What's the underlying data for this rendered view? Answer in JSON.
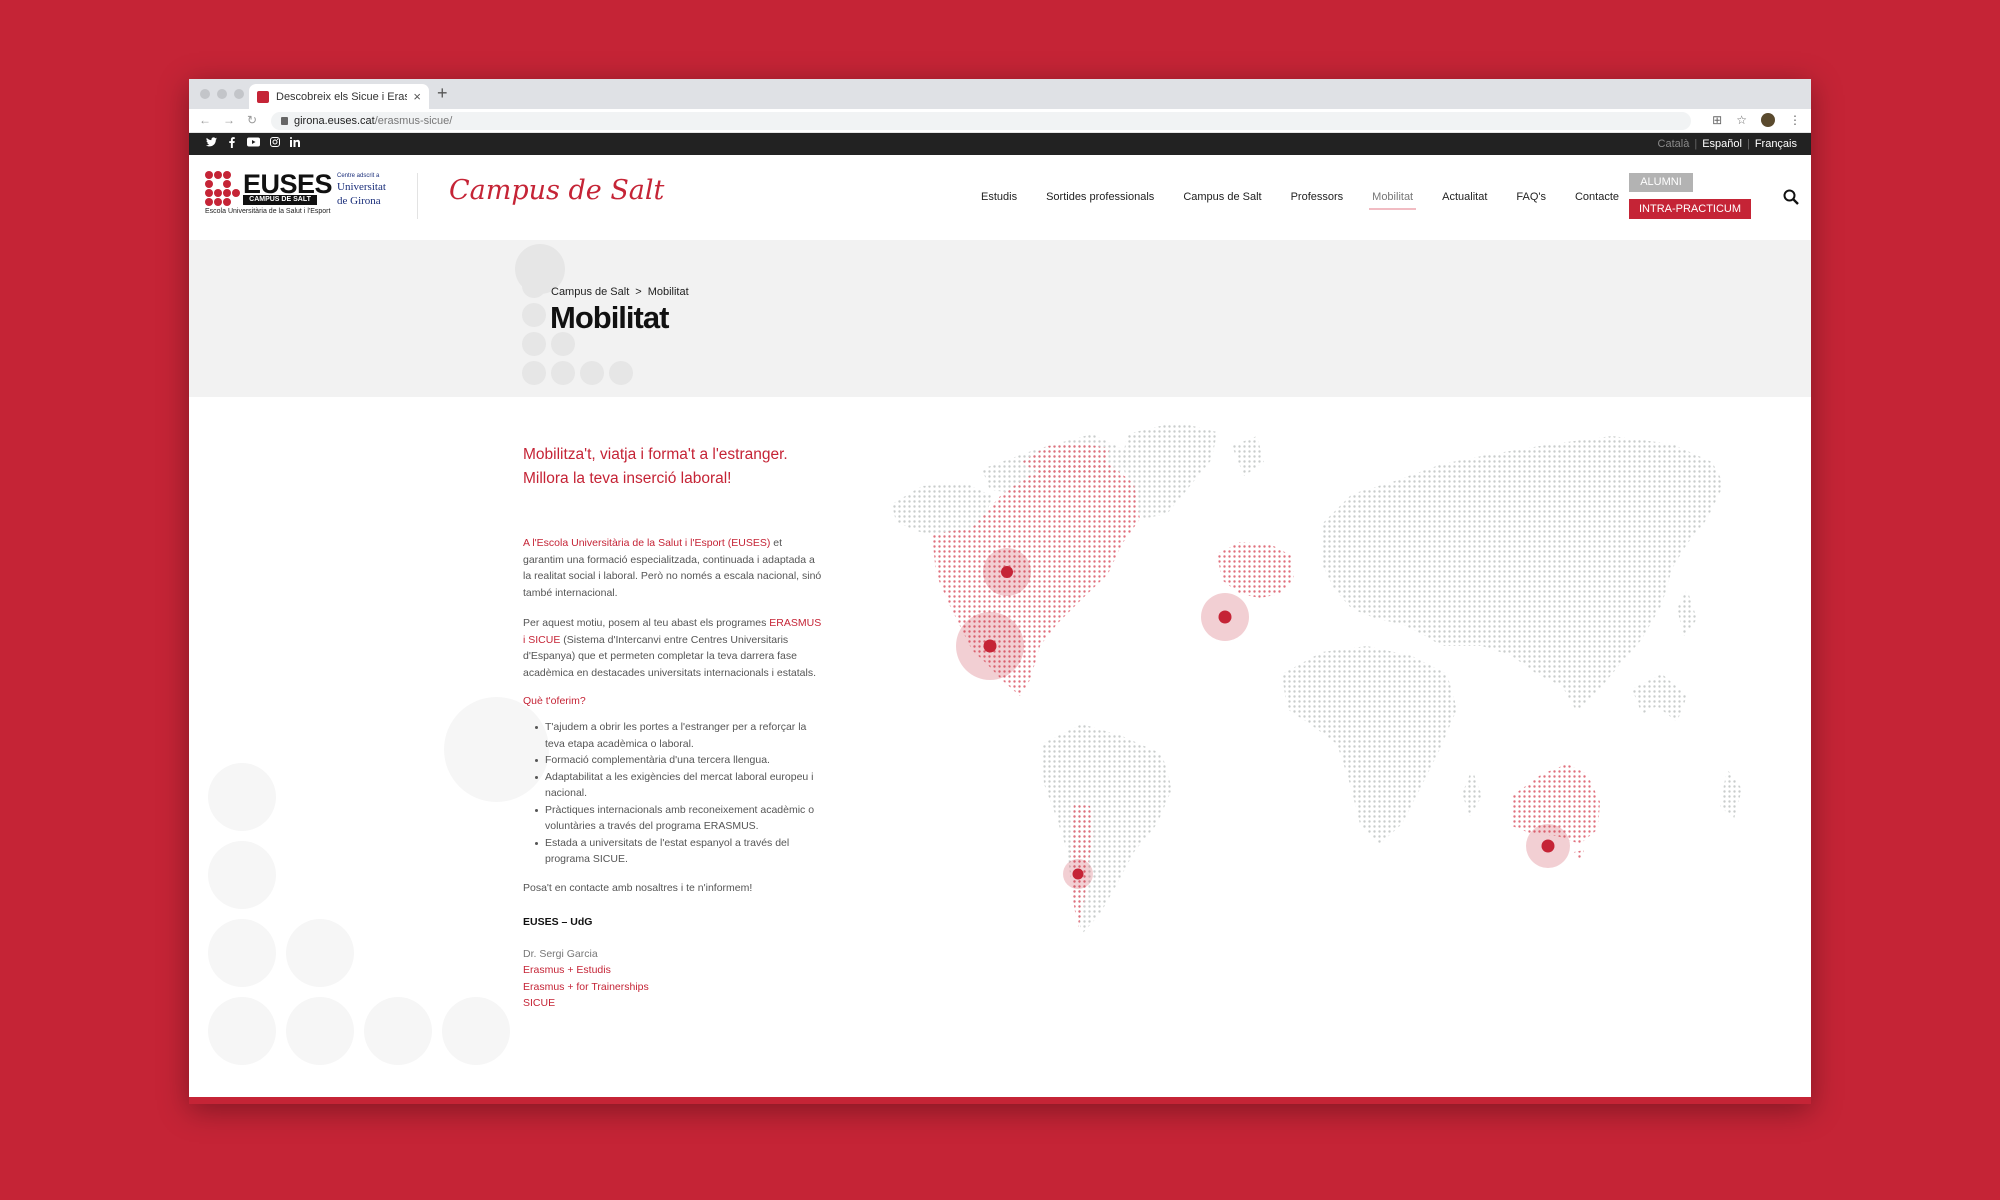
{
  "browser": {
    "tab_title": "Descobreix els Sicue i Erasmus",
    "tab_close": "×",
    "new_tab": "+",
    "url_host": "girona.euses.cat",
    "url_path": "/erasmus-sicue/"
  },
  "topbar": {
    "social": [
      "twitter-icon",
      "facebook-icon",
      "youtube-icon",
      "instagram-icon",
      "linkedin-icon"
    ],
    "languages": [
      {
        "label": "Català",
        "active": false
      },
      {
        "label": "Español",
        "active": true
      },
      {
        "label": "Français",
        "active": true
      }
    ]
  },
  "header": {
    "logo_name": "EUSES",
    "logo_campus": "CAMPUS DE SALT",
    "logo_sub": "Escola Universitària de la Salut i l'Esport",
    "udg_small": "Centre adscrit a",
    "udg_line1": "Universitat",
    "udg_line2": "de Girona",
    "campus_title": "Campus de Salt",
    "nav": [
      "Estudis",
      "Sortides professionals",
      "Campus de Salt",
      "Professors",
      "Mobilitat",
      "Actualitat",
      "FAQ's",
      "Contacte"
    ],
    "nav_active": "Mobilitat",
    "alumni_label": "ALUMNI",
    "intra_label": "INTRA-PRACTICUM"
  },
  "hero": {
    "breadcrumb": [
      "Campus de Salt",
      "Mobilitat"
    ],
    "breadcrumb_sep": ">",
    "title": "Mobilitat"
  },
  "content": {
    "lead": "Mobilitza't, viatja i forma't a l'estranger. Millora la teva inserció laboral!",
    "p1_red": "A l'Escola Universitària de la Salut i l'Esport (EUSES)",
    "p1_rest": " et garantim una formació especialitzada, continuada i adaptada a la realitat social i laboral. Però no només a escala nacional, sinó també internacional.",
    "p2_start": "Per aquest motiu, posem al teu abast els programes ",
    "p2_red": "ERASMUS i SICUE",
    "p2_rest": " (Sistema d'Intercanvi entre Centres Universitaris d'Espanya) que et permeten completar la teva darrera fase acadèmica en destacades universitats internacionals i estatals.",
    "offer_heading": "Què t'oferim?",
    "offers": [
      "T'ajudem a obrir les portes a l'estranger per a reforçar la teva etapa acadèmica o laboral.",
      "Formació complementària d'una tercera llengua.",
      "Adaptabilitat a les exigències del mercat laboral europeu i nacional.",
      "Pràctiques internacionals amb reconeixement acadèmic o voluntàries a través del programa ERASMUS.",
      "Estada a universitats de l'estat espanyol a través del programa SICUE."
    ],
    "contact": "Posa't en contacte amb nosaltres i te n'informem!",
    "org": "EUSES – UdG",
    "person": "Dr. Sergi Garcia",
    "links": [
      "Erasmus + Estudis",
      "Erasmus + for Trainerships",
      "SICUE"
    ]
  },
  "map": {
    "highlight_regions": [
      "North America",
      "Europe",
      "Chile",
      "Australia"
    ],
    "markers": [
      "Canada",
      "USA",
      "Europe",
      "Chile",
      "Australia"
    ],
    "colors": {
      "land": "#c9cdcc",
      "highlight": "#e0707d",
      "marker": "#c52436",
      "halo": "rgba(197,36,54,0.22)"
    }
  }
}
